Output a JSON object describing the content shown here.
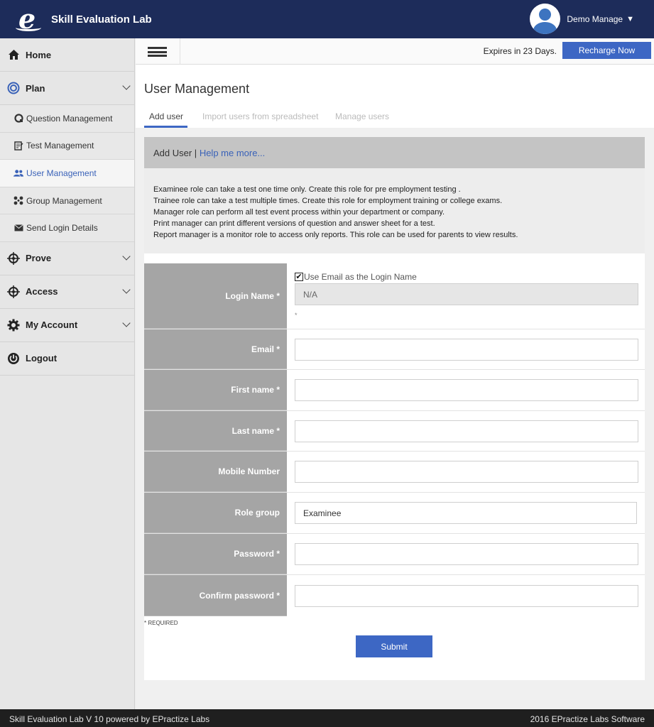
{
  "header": {
    "logo_letter": "e",
    "app_title": "Skill Evaluation Lab",
    "user_name": "Demo Manage",
    "caret": "▼"
  },
  "sidebar": {
    "home": {
      "label": "Home",
      "icon": "home-icon"
    },
    "plan": {
      "label": "Plan",
      "icon": "target-icon"
    },
    "plan_items": [
      {
        "label": "Question Management",
        "icon": "question-icon"
      },
      {
        "label": "Test Management",
        "icon": "test-icon"
      },
      {
        "label": "User Management",
        "icon": "users-icon"
      },
      {
        "label": "Group Management",
        "icon": "group-icon"
      },
      {
        "label": "Send Login Details",
        "icon": "envelope-icon"
      }
    ],
    "prove": {
      "label": "Prove",
      "icon": "crosshair-icon"
    },
    "access": {
      "label": "Access",
      "icon": "crosshair-icon"
    },
    "my_account": {
      "label": "My Account",
      "icon": "gear-icon"
    },
    "logout": {
      "label": "Logout",
      "icon": "power-icon"
    }
  },
  "toolbar": {
    "expires": "Expires in 23 Days.",
    "recharge_label": "Recharge Now"
  },
  "page": {
    "title": "User Management",
    "tabs": [
      "Add user",
      "Import users from spreadsheet",
      "Manage users"
    ],
    "active_tab": "Add user"
  },
  "panel": {
    "title": "Add User |",
    "help_link": "Help me more...",
    "info": [
      "Examinee role can take a test one time only. Create this role for pre employment testing .",
      "Trainee role can take a test multiple times. Create this role for employment training or college exams.",
      "Manager role can perform all test event process within your department or company.",
      "Print manager can print different versions of question and answer sheet for a test.",
      "Report manager is a monitor role to access only reports. This role can be used for parents to view results."
    ]
  },
  "form": {
    "login_name_label": "Login Name *",
    "use_email_checkbox": "Use Email as the Login Name",
    "use_email_checked": true,
    "login_name_value": "N/A",
    "login_name_note": "*",
    "email_label": "Email *",
    "first_name_label": "First name *",
    "last_name_label": "Last name *",
    "mobile_label": "Mobile Number",
    "role_group_label": "Role group",
    "role_group_value": "Examinee",
    "password_label": "Password *",
    "confirm_password_label": "Confirm password *",
    "required_note": "* REQUIRED",
    "submit_label": "Submit"
  },
  "footer": {
    "left": "Skill Evaluation Lab V 10 powered by EPractize Labs",
    "right": "2016 EPractize Labs Software"
  },
  "colors": {
    "header_bg": "#1d2c5a",
    "accent": "#3d67c4",
    "footer_bg": "#1f1f1f"
  }
}
